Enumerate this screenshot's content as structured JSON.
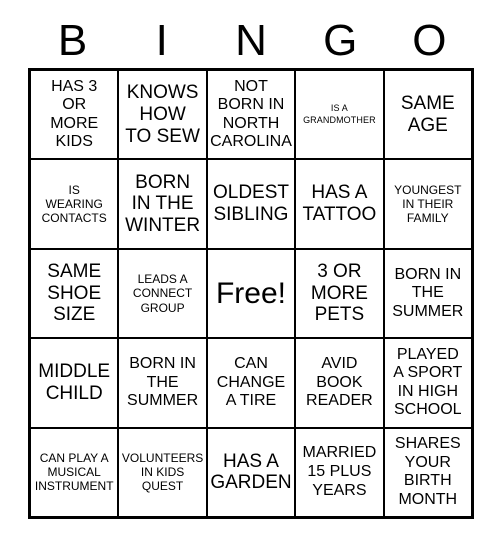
{
  "card": {
    "title": "BINGO",
    "header_letters": [
      "B",
      "I",
      "N",
      "G",
      "O"
    ],
    "rows": 5,
    "columns": 5,
    "border_color": "#000000",
    "background_color": "#ffffff",
    "text_color": "#000000",
    "free_space": {
      "label": "Free!",
      "row": 3,
      "column": 3
    },
    "cells": [
      {
        "text": "HAS 3\nOR\nMORE\nKIDS",
        "size": "md"
      },
      {
        "text": "KNOWS\nHOW\nTO SEW",
        "size": "lg"
      },
      {
        "text": "NOT\nBORN IN\nNORTH\nCAROLINA",
        "size": "md"
      },
      {
        "text": "IS A\nGRANDMOTHER",
        "size": "xs"
      },
      {
        "text": "SAME\nAGE",
        "size": "lg"
      },
      {
        "text": "IS\nWEARING\nCONTACTS",
        "size": "sm"
      },
      {
        "text": "BORN\nIN THE\nWINTER",
        "size": "lg"
      },
      {
        "text": "OLDEST\nSIBLING",
        "size": "lg"
      },
      {
        "text": "HAS A\nTATTOO",
        "size": "lg"
      },
      {
        "text": "YOUNGEST\nIN THEIR\nFAMILY",
        "size": "sm"
      },
      {
        "text": "SAME\nSHOE\nSIZE",
        "size": "lg"
      },
      {
        "text": "LEADS A\nCONNECT\nGROUP",
        "size": "sm"
      },
      {
        "text": "Free!",
        "size": "xl"
      },
      {
        "text": "3 OR\nMORE\nPETS",
        "size": "lg"
      },
      {
        "text": "BORN IN\nTHE\nSUMMER",
        "size": "md"
      },
      {
        "text": "MIDDLE\nCHILD",
        "size": "lg"
      },
      {
        "text": "BORN IN\nTHE\nSUMMER",
        "size": "md"
      },
      {
        "text": "CAN\nCHANGE\nA TIRE",
        "size": "md"
      },
      {
        "text": "AVID\nBOOK\nREADER",
        "size": "md"
      },
      {
        "text": "PLAYED\nA SPORT\nIN HIGH\nSCHOOL",
        "size": "md"
      },
      {
        "text": "CAN PLAY A\nMUSICAL\nINSTRUMENT",
        "size": "sm"
      },
      {
        "text": "VOLUNTEERS\nIN KIDS\nQUEST",
        "size": "sm"
      },
      {
        "text": "HAS A\nGARDEN",
        "size": "lg"
      },
      {
        "text": "MARRIED\n15 PLUS\nYEARS",
        "size": "md"
      },
      {
        "text": "SHARES\nYOUR\nBIRTH\nMONTH",
        "size": "md"
      }
    ]
  }
}
